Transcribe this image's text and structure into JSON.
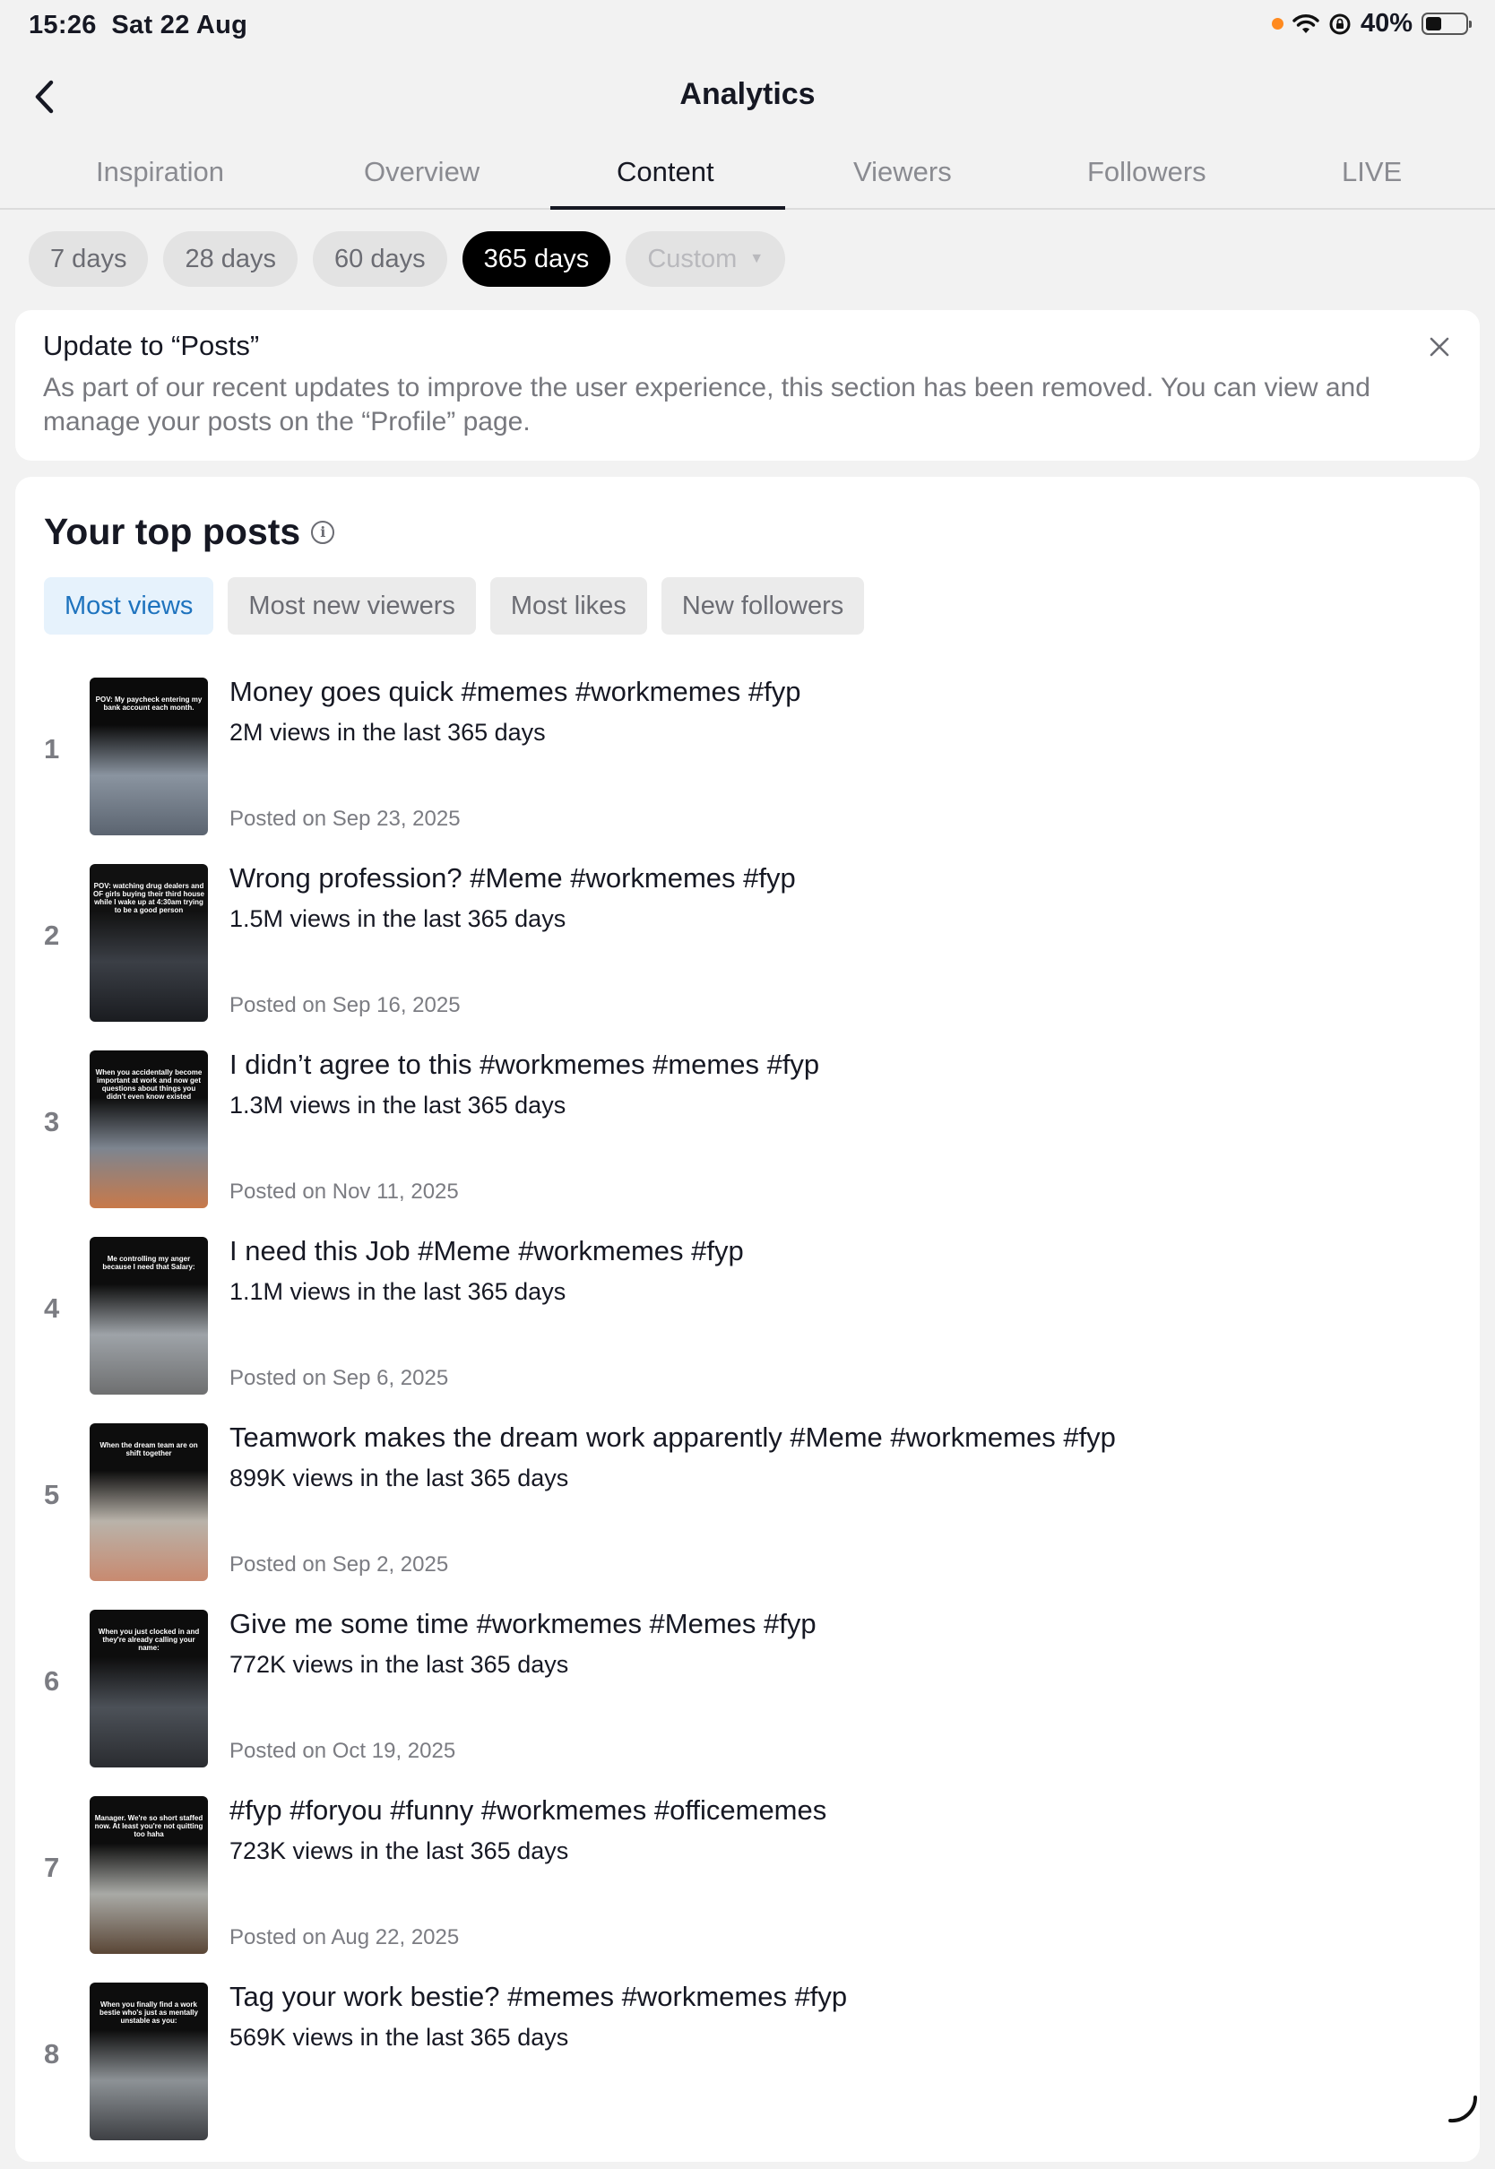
{
  "status_bar": {
    "time": "15:26",
    "date": "Sat 22 Aug",
    "battery_percent": "40%",
    "battery_level": 0.4,
    "dot_color": "#ff8a1f"
  },
  "nav": {
    "title": "Analytics",
    "back_icon": "chevron-left-icon"
  },
  "tabs": [
    {
      "label": "Inspiration",
      "active": false
    },
    {
      "label": "Overview",
      "active": false
    },
    {
      "label": "Content",
      "active": true
    },
    {
      "label": "Viewers",
      "active": false
    },
    {
      "label": "Followers",
      "active": false
    },
    {
      "label": "LIVE",
      "active": false
    }
  ],
  "date_ranges": [
    {
      "label": "7 days",
      "state": "normal"
    },
    {
      "label": "28 days",
      "state": "normal"
    },
    {
      "label": "60 days",
      "state": "normal"
    },
    {
      "label": "365 days",
      "state": "active"
    },
    {
      "label": "Custom",
      "state": "disabled"
    }
  ],
  "notice": {
    "title": "Update to “Posts”",
    "body": "As part of our recent updates to improve the user experience, this section has been removed. You can view and manage your posts on the “Profile” page.",
    "close_icon": "close-icon"
  },
  "top_posts": {
    "title": "Your top posts",
    "filters": [
      {
        "label": "Most views",
        "active": true
      },
      {
        "label": "Most new viewers",
        "active": false
      },
      {
        "label": "Most likes",
        "active": false
      },
      {
        "label": "New followers",
        "active": false
      }
    ],
    "posts": [
      {
        "rank": "1",
        "title": "Money goes quick #memes #workmemes #fyp",
        "views": "2M views in the last 365 days",
        "posted": "Posted on Sep 23, 2025",
        "thumb_caption": "POV: My paycheck entering my bank account each month.",
        "thumb_colors": [
          "#0b0b0b",
          "#8a94a0",
          "#5b6470"
        ]
      },
      {
        "rank": "2",
        "title": "Wrong profession? #Meme #workmemes #fyp",
        "views": "1.5M views in the last 365 days",
        "posted": "Posted on Sep 16, 2025",
        "thumb_caption": "POV: watching drug dealers and OF girls buying their third house while I wake up at 4:30am trying to be a good person",
        "thumb_colors": [
          "#111111",
          "#3b3f46",
          "#1a1c20"
        ]
      },
      {
        "rank": "3",
        "title": "I didn’t agree to this #workmemes #memes #fyp",
        "views": "1.3M views in the last 365 days",
        "posted": "Posted on Nov 11, 2025",
        "thumb_caption": "When you accidentally become important at work and now get questions about things you didn't even know existed",
        "thumb_colors": [
          "#0d0d0d",
          "#7d8590",
          "#c8794a"
        ]
      },
      {
        "rank": "4",
        "title": "I need this Job #Meme #workmemes #fyp",
        "views": "1.1M views in the last 365 days",
        "posted": "Posted on Sep 6, 2025",
        "thumb_caption": "Me controlling my anger because I need that Salary:",
        "thumb_colors": [
          "#0d0d0d",
          "#9ea3a8",
          "#6e6f70"
        ]
      },
      {
        "rank": "5",
        "title": "Teamwork makes the dream work apparently #Meme #workmemes #fyp",
        "views": "899K views in the last 365 days",
        "posted": "Posted on Sep 2, 2025",
        "thumb_caption": "When the dream team are on shift together",
        "thumb_colors": [
          "#0d0d0d",
          "#b9b3aa",
          "#c88a70"
        ]
      },
      {
        "rank": "6",
        "title": "Give me some time #workmemes #Memes #fyp",
        "views": "772K views in the last 365 days",
        "posted": "Posted on Oct 19, 2025",
        "thumb_caption": "When you just clocked in and they're already calling your name:",
        "thumb_colors": [
          "#0d0d0d",
          "#4c5158",
          "#2a2c30"
        ]
      },
      {
        "rank": "7",
        "title": "#fyp #foryou #funny #workmemes #officememes",
        "views": "723K views in the last 365 days",
        "posted": "Posted on Aug 22, 2025",
        "thumb_caption": "Manager. We're so short staffed now. At least you're not quitting too haha",
        "thumb_colors": [
          "#0d0d0d",
          "#a9aaa6",
          "#5a4636"
        ]
      },
      {
        "rank": "8",
        "title": "Tag your work bestie? #memes #workmemes #fyp",
        "views": "569K views in the last 365 days",
        "posted": "",
        "thumb_caption": "When you finally find a work bestie who's just as mentally unstable as you:",
        "thumb_colors": [
          "#0d0d0d",
          "#8d9296",
          "#3e4044"
        ]
      }
    ]
  }
}
